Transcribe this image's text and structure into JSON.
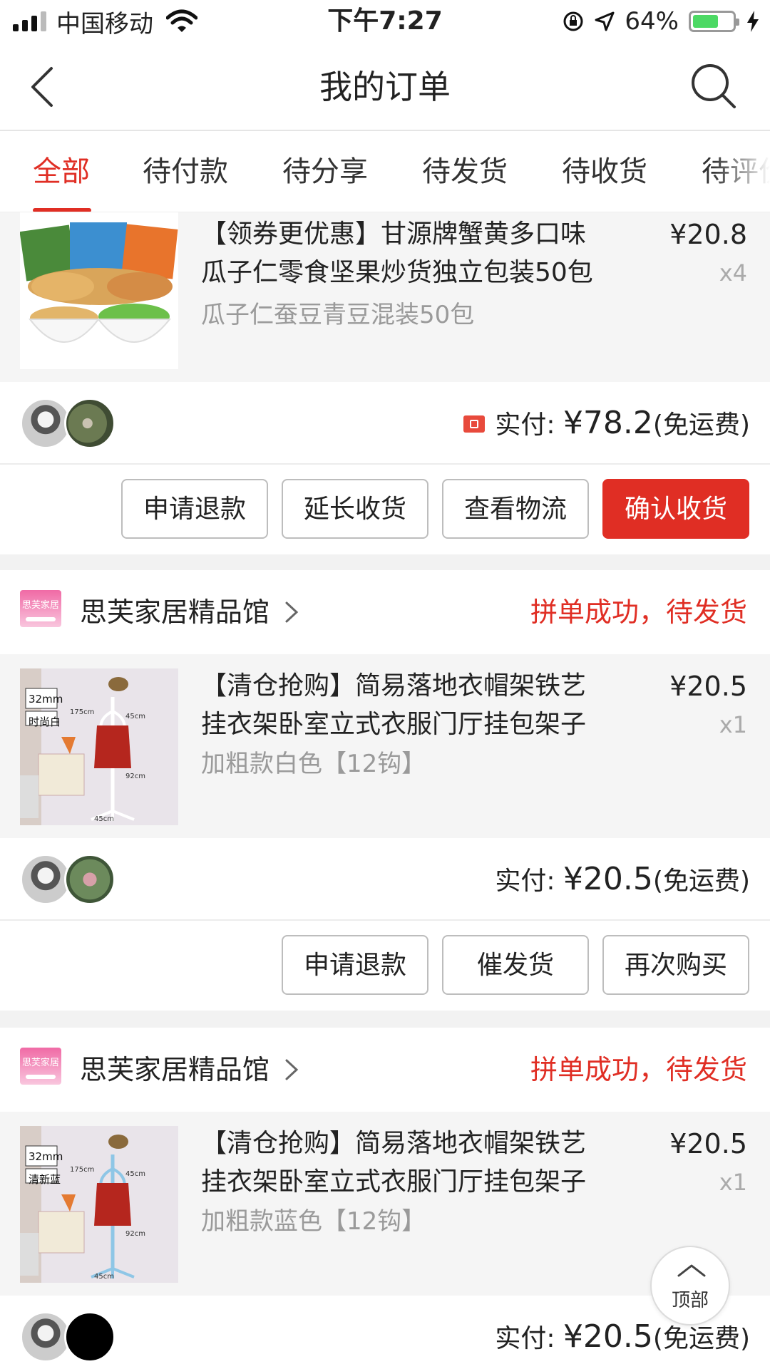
{
  "status_bar": {
    "carrier": "中国移动",
    "time": "下午7:27",
    "battery_percent": "64%",
    "battery_level": 0.64,
    "icons": [
      "signal-icon",
      "wifi-icon",
      "rotation-lock-icon",
      "location-arrow-icon",
      "battery-icon",
      "charging-bolt-icon"
    ]
  },
  "nav": {
    "title": "我的订单",
    "back_icon": "chevron-left-icon",
    "search_icon": "search-icon"
  },
  "tabs": [
    "全部",
    "待付款",
    "待分享",
    "待发货",
    "待收货",
    "待评价"
  ],
  "active_tab_index": 0,
  "orders": [
    {
      "product": {
        "title_line1": "【领券更优惠】甘源牌蟹黄多口味",
        "title_line2": "瓜子仁零食坚果炒货独立包装50包",
        "spec": "瓜子仁蚕豆青豆混装50包",
        "price": "¥20.8",
        "qty": "x4"
      },
      "payment": {
        "label": "实付: ",
        "amount": "¥78.2",
        "note": "(免运费)"
      },
      "buttons": [
        "申请退款",
        "延长收货",
        "查看物流",
        "确认收货"
      ]
    },
    {
      "shop_logo_text": "思芙家居",
      "shop_name": "思芙家居精品馆",
      "status": "拼单成功，待发货",
      "product": {
        "title_line1": "【清仓抢购】简易落地衣帽架铁艺",
        "title_line2": "挂衣架卧室立式衣服门厅挂包架子",
        "spec": "加粗款白色【12钩】",
        "price": "¥20.5",
        "qty": "x1",
        "image_tags": [
          "32mm",
          "时尚白"
        ],
        "image_dims": [
          "175cm",
          "45cm",
          "92cm",
          "45cm"
        ]
      },
      "payment": {
        "label": "实付: ",
        "amount": "¥20.5",
        "note": "(免运费)"
      },
      "buttons": [
        "申请退款",
        "催发货",
        "再次购买"
      ]
    },
    {
      "shop_logo_text": "思芙家居",
      "shop_name": "思芙家居精品馆",
      "status": "拼单成功，待发货",
      "product": {
        "title_line1": "【清仓抢购】简易落地衣帽架铁艺",
        "title_line2": "挂衣架卧室立式衣服门厅挂包架子",
        "spec": "加粗款蓝色【12钩】",
        "price": "¥20.5",
        "qty": "x1",
        "image_tags": [
          "32mm",
          "清新蓝"
        ],
        "image_dims": [
          "175cm",
          "45cm",
          "92cm",
          "45cm"
        ]
      },
      "payment": {
        "label": "实付: ",
        "amount": "¥20.5",
        "note": "(免运费)"
      }
    }
  ],
  "back_to_top": "顶部",
  "colors": {
    "accent": "#e02e24",
    "product_bg": "#f5f5f5",
    "gap_bg": "#f2f2f2"
  }
}
